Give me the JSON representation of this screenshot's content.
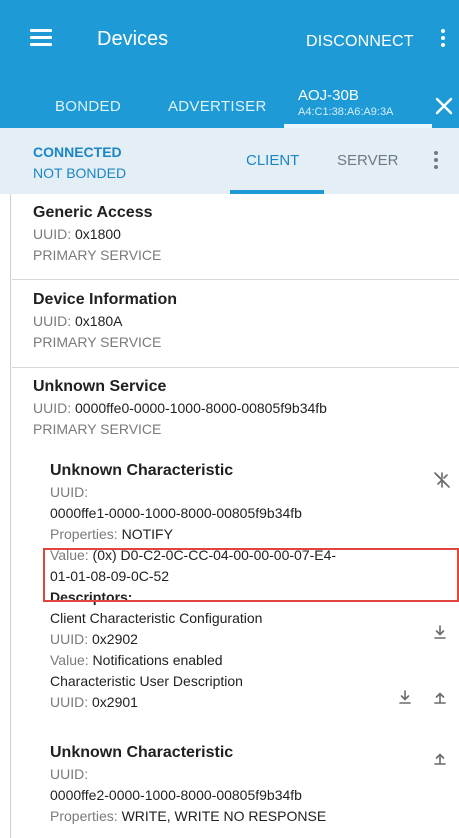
{
  "appbar": {
    "title": "Devices",
    "disconnect_label": "DISCONNECT"
  },
  "tabs": {
    "bonded": "BONDED",
    "advertiser": "ADVERTISER",
    "device_name": "AOJ-30B",
    "device_address": "A4:C1:38:A6:A9:3A"
  },
  "connection": {
    "state": "CONNECTED",
    "bond": "NOT BONDED",
    "client_tab": "CLIENT",
    "server_tab": "SERVER"
  },
  "services": [
    {
      "name": "Generic Access",
      "uuid_label": "UUID: ",
      "uuid": "0x1800",
      "type": "PRIMARY SERVICE"
    },
    {
      "name": "Device Information",
      "uuid_label": "UUID: ",
      "uuid": "0x180A",
      "type": "PRIMARY SERVICE"
    },
    {
      "name": "Unknown Service",
      "uuid_label": "UUID: ",
      "uuid": "0000ffe0-0000-1000-8000-00805f9b34fb",
      "type": "PRIMARY SERVICE"
    }
  ],
  "characteristics": [
    {
      "name": "Unknown Characteristic",
      "uuid_label": "UUID:",
      "uuid": "0000ffe1-0000-1000-8000-00805f9b34fb",
      "properties_label": "Properties: ",
      "properties": "NOTIFY",
      "value_label": "Value: ",
      "value_line1": "(0x) D0-C2-0C-CC-04-00-00-00-07-E4-",
      "value_line2": "01-01-08-09-0C-52",
      "descriptors_label": "Descriptors:",
      "descriptors": [
        {
          "name": "Client Characteristic Configuration",
          "uuid_label": "UUID: ",
          "uuid": "0x2902",
          "value_label": "Value: ",
          "value": "Notifications enabled"
        },
        {
          "name": "Characteristic User Description",
          "uuid_label": "UUID: ",
          "uuid": "0x2901"
        }
      ]
    },
    {
      "name": "Unknown Characteristic",
      "uuid_label": "UUID:",
      "uuid": "0000ffe2-0000-1000-8000-00805f9b34fb",
      "properties_label": "Properties: ",
      "properties": "WRITE, WRITE NO RESPONSE"
    }
  ],
  "colors": {
    "primary": "#1e9bd7",
    "accent_text": "#1a86c7",
    "highlight_box": "#e0463e"
  },
  "icons": [
    "menu-icon",
    "more-vert-icon",
    "close-icon",
    "notifications-off-icon",
    "download-icon",
    "upload-icon"
  ]
}
